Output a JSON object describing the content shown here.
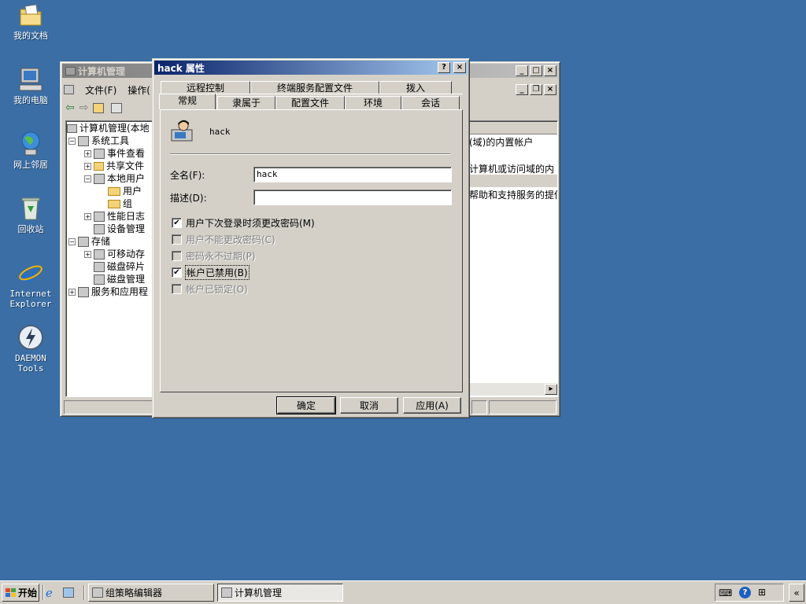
{
  "desktop": {
    "icons": [
      {
        "label": "我的文档",
        "icon": "my-documents-icon"
      },
      {
        "label": "我的电脑",
        "icon": "my-computer-icon"
      },
      {
        "label": "网上邻居",
        "icon": "network-icon"
      },
      {
        "label": "回收站",
        "icon": "recycle-bin-icon"
      },
      {
        "label_line1": "Internet",
        "label_line2": "Explorer",
        "icon": "internet-explorer-icon"
      },
      {
        "label": "DAEMON Tools",
        "icon": "daemon-tools-icon"
      }
    ]
  },
  "computer_management": {
    "title": "计算机管理",
    "menu": {
      "file": "文件(F)",
      "action": "操作("
    },
    "tree": [
      {
        "label": "计算机管理(本地"
      },
      {
        "label": "系统工具"
      },
      {
        "label": "事件查看"
      },
      {
        "label": "共享文件"
      },
      {
        "label": "本地用户"
      },
      {
        "label": "用户"
      },
      {
        "label": "组"
      },
      {
        "label": "性能日志"
      },
      {
        "label": "设备管理"
      },
      {
        "label": "存储"
      },
      {
        "label": "可移动存"
      },
      {
        "label": "磁盘碎片"
      },
      {
        "label": "磁盘管理"
      },
      {
        "label": "服务和应用程"
      }
    ],
    "list_fragments": [
      "(域)的内置帐户",
      "计算机或访问域的内",
      "帮助和支持服务的提供"
    ]
  },
  "dialog": {
    "title": "hack 属性",
    "help_btn": "?",
    "close_btn": "×",
    "tabs_back": [
      "远程控制",
      "终端服务配置文件",
      "拨入"
    ],
    "tabs_front": [
      "常规",
      "隶属于",
      "配置文件",
      "环境",
      "会话"
    ],
    "username": "hack",
    "fullname_label": "全名(F):",
    "fullname_value": "hack",
    "description_label": "描述(D):",
    "description_value": "",
    "checkboxes": [
      {
        "label": "用户下次登录时须更改密码(M)",
        "checked": true,
        "enabled": true
      },
      {
        "label": "用户不能更改密码(C)",
        "checked": false,
        "enabled": false
      },
      {
        "label": "密码永不过期(P)",
        "checked": false,
        "enabled": false
      },
      {
        "label": "帐户已禁用(B)",
        "checked": true,
        "enabled": true
      },
      {
        "label": "帐户已锁定(O)",
        "checked": false,
        "enabled": false
      }
    ],
    "ok": "确定",
    "cancel": "取消",
    "apply": "应用(A)"
  },
  "taskbar": {
    "start": "开始",
    "tasks": [
      {
        "label": "组策略编辑器",
        "pressed": false
      },
      {
        "label": "计算机管理",
        "pressed": true
      }
    ],
    "chevron": "«"
  }
}
